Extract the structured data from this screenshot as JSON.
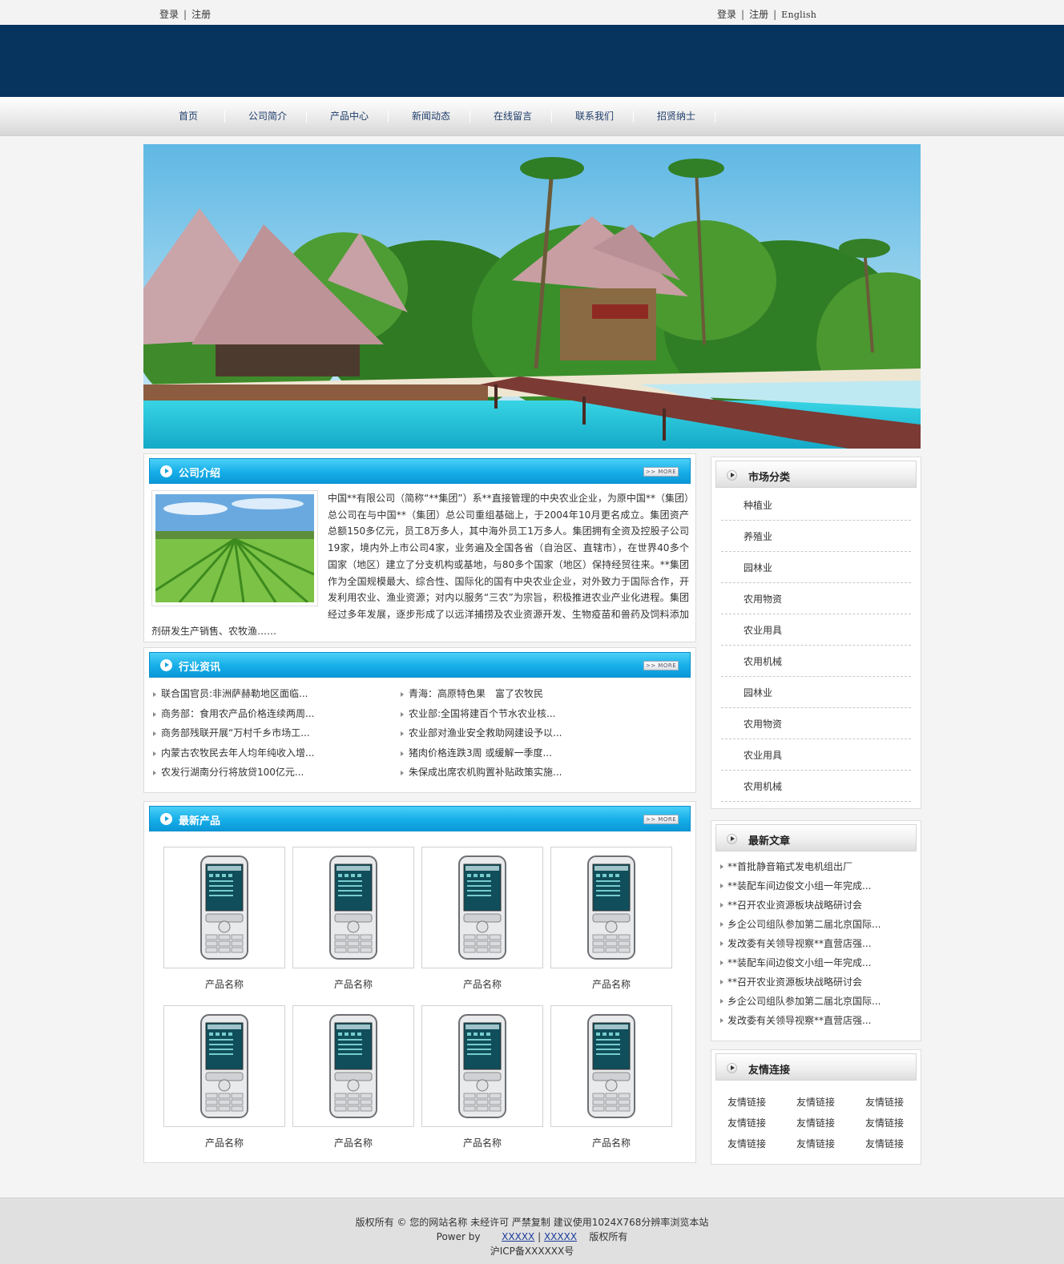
{
  "topbar": {
    "left": {
      "login": "登录",
      "register": "注册"
    },
    "right": {
      "login": "登录",
      "register": "注册",
      "english": "English"
    },
    "separator": "|"
  },
  "nav": {
    "items": [
      "首页",
      "公司简介",
      "产品中心",
      "新闻动态",
      "在线留言",
      "联系我们",
      "招贤纳士"
    ]
  },
  "more_label": ">> MORE",
  "intro": {
    "title": "公司介绍",
    "text": "中国**有限公司（简称“**集团”）系**直接管理的中央农业企业，为原中国**（集团）总公司在与中国**（集团）总公司重组基础上，于2004年10月更名成立。集团资产总额150多亿元，员工8万多人，其中海外员工1万多人。集团拥有全资及控股子公司19家，境内外上市公司4家，业务遍及全国各省（自治区、直辖市），在世界40多个国家（地区）建立了分支机构或基地，与80多个国家（地区）保持经贸往来。**集团作为全国规模最大、综合性、国际化的国有中央农业企业，对外致力于国际合作，开发利用农业、渔业资源；对内以服务“三农”为宗旨，积极推进农业产业化进程。集团经过多年发展，逐步形成了以远洋捕捞及农业资源开发、生物疫苗和兽药及饲料添加剂研发生产销售、农牧渔……"
  },
  "industry": {
    "title": "行业资讯",
    "left": [
      "联合国官员:非洲萨赫勒地区面临...",
      "商务部：食用农产品价格连续两周...",
      "商务部残联开展“万村千乡市场工...",
      "内蒙古农牧民去年人均年纯收入增...",
      "农发行湖南分行将放贷100亿元..."
    ],
    "right": [
      "青海：高原特色果　富了农牧民",
      "农业部:全国将建百个节水农业核...",
      "农业部对渔业安全救助网建设予以...",
      "猪肉价格连跌3周  或缓解一季度...",
      "朱保成出席农机购置补贴政策实施..."
    ]
  },
  "products": {
    "title": "最新产品",
    "items": [
      "产品名称",
      "产品名称",
      "产品名称",
      "产品名称",
      "产品名称",
      "产品名称",
      "产品名称",
      "产品名称"
    ]
  },
  "market": {
    "title": "市场分类",
    "items": [
      "种植业",
      "养殖业",
      "园林业",
      "农用物资",
      "农业用具",
      "农用机械",
      "园林业",
      "农用物资",
      "农业用具",
      "农用机械"
    ]
  },
  "articles": {
    "title": "最新文章",
    "items": [
      "**首批静音箱式发电机组出厂",
      "**装配车间边俊文小组一年完成...",
      "**召开农业资源板块战略研讨会",
      "乡企公司组队参加第二届北京国际...",
      "发改委有关领导视察**直营店强...",
      "**装配车间边俊文小组一年完成...",
      "**召开农业资源板块战略研讨会",
      "乡企公司组队参加第二届北京国际...",
      "发改委有关领导视察**直营店强..."
    ]
  },
  "friends": {
    "title": "友情连接",
    "items": [
      "友情链接",
      "友情链接",
      "友情链接",
      "友情链接",
      "友情链接",
      "友情链接",
      "友情链接",
      "友情链接",
      "友情链接"
    ]
  },
  "footer": {
    "line1": "版权所有 © 您的网站名称  未经许可  严禁复制  建议使用1024X768分辨率浏览本站",
    "power_by": "Power by",
    "link1": "XXXXX",
    "link2": "XXXXX",
    "rights": "版权所有",
    "icp": "沪ICP备XXXXXX号"
  },
  "colors": {
    "header_dark": "#07345f",
    "nav_text": "#1e3d6b",
    "blue_bar": "#16aee8",
    "footer_link": "#1a3c9b"
  }
}
